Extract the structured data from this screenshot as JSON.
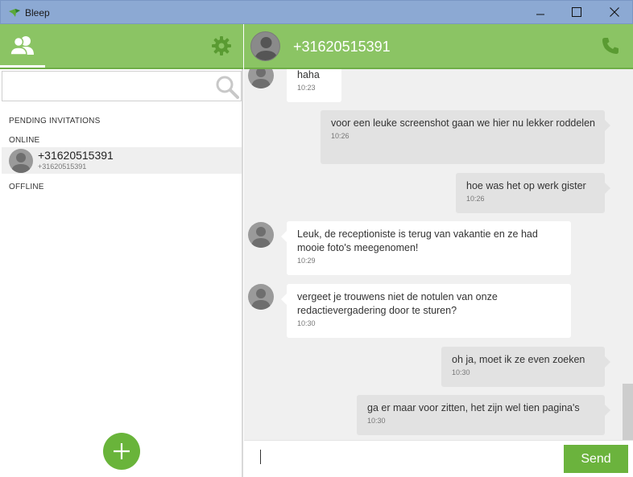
{
  "window": {
    "title": "Bleep"
  },
  "sidebar": {
    "search_placeholder": "",
    "sections": {
      "pending": "PENDING INVITATIONS",
      "online": "ONLINE",
      "offline": "OFFLINE"
    },
    "contacts": [
      {
        "name": "+31620515391",
        "sub": "+31620515391",
        "status": "online"
      }
    ]
  },
  "chat": {
    "contact_title": "+31620515391",
    "messages": [
      {
        "direction": "in",
        "text": "haha",
        "time": "10:23"
      },
      {
        "direction": "out",
        "text": "voor een leuke screenshot gaan we hier nu lekker roddelen",
        "time": "10:26"
      },
      {
        "direction": "out",
        "text": "hoe was het op werk gister",
        "time": "10:26"
      },
      {
        "direction": "in",
        "text": "Leuk, de receptioniste is terug van vakantie en ze had mooie foto's meegenomen!",
        "time": "10:29"
      },
      {
        "direction": "in",
        "text": "vergeet je trouwens niet de notulen van onze redactievergadering door te sturen?",
        "time": "10:30"
      },
      {
        "direction": "out",
        "text": "oh ja, moet ik ze even zoeken",
        "time": "10:30"
      },
      {
        "direction": "out",
        "text": "ga er maar voor zitten, het zijn wel tien pagina's",
        "time": "10:30"
      }
    ],
    "compose_value": "",
    "send_label": "Send"
  },
  "colors": {
    "accent_green": "#8bc464",
    "button_green": "#6bb33d",
    "titlebar_blue": "#8ca9d3"
  },
  "icons": [
    "contacts-icon",
    "gear-icon",
    "search-icon",
    "avatar-icon",
    "phone-icon",
    "plus-icon",
    "minimize-icon",
    "maximize-icon",
    "close-icon"
  ]
}
